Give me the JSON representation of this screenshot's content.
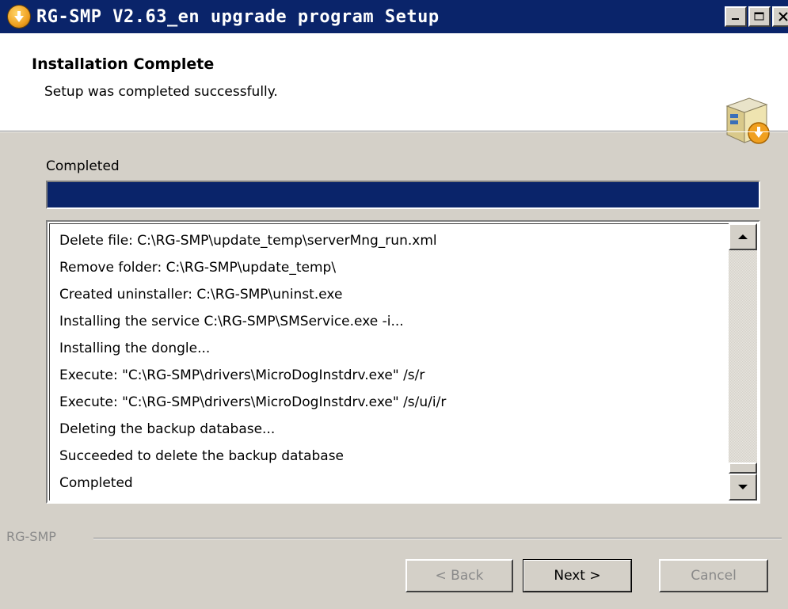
{
  "window": {
    "title": "RG-SMP V2.63_en upgrade program Setup",
    "app_icon": "installer-arrow-icon"
  },
  "header": {
    "title": "Installation Complete",
    "subtitle": "Setup was completed successfully.",
    "icon": "setup-box-icon"
  },
  "status": {
    "label": "Completed",
    "progress": 1.0
  },
  "log": {
    "lines": [
      "Delete file: C:\\RG-SMP\\update_temp\\serverMng_run.xml",
      "Remove folder: C:\\RG-SMP\\update_temp\\",
      "Created uninstaller: C:\\RG-SMP\\uninst.exe",
      "Installing the service C:\\RG-SMP\\SMService.exe -i...",
      "Installing the dongle...",
      "Execute: \"C:\\RG-SMP\\drivers\\MicroDogInstdrv.exe\" /s/r",
      "Execute: \"C:\\RG-SMP\\drivers\\MicroDogInstdrv.exe\" /s/u/i/r",
      "Deleting the backup database...",
      "Succeeded to delete the backup database",
      "Completed"
    ]
  },
  "footer": {
    "brand": "RG-SMP",
    "back_label": "< Back",
    "next_label": "Next >",
    "cancel_label": "Cancel"
  },
  "colors": {
    "titlebar": "#0a246a",
    "progress": "#0a246a",
    "face": "#d4d0c8"
  }
}
